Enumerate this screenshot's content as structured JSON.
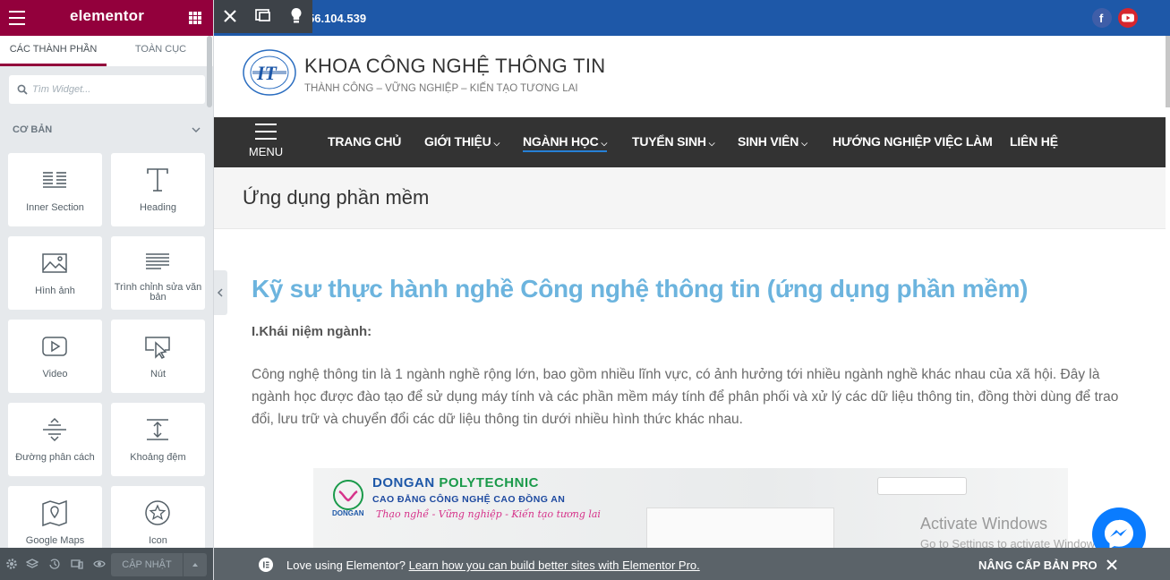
{
  "panel": {
    "brand": "elementor",
    "tabs": [
      "CÁC THÀNH PHẦN",
      "TOÀN CỤC"
    ],
    "search_placeholder": "Tìm Widget...",
    "category": "CƠ BẢN",
    "widgets": [
      {
        "label": "Inner Section",
        "icon": "inner-section-icon"
      },
      {
        "label": "Heading",
        "icon": "heading-icon"
      },
      {
        "label": "Hình ảnh",
        "icon": "image-icon"
      },
      {
        "label": "Trình chỉnh sửa văn bản",
        "icon": "text-editor-icon"
      },
      {
        "label": "Video",
        "icon": "video-icon"
      },
      {
        "label": "Nút",
        "icon": "button-icon"
      },
      {
        "label": "Đường phân cách",
        "icon": "divider-icon"
      },
      {
        "label": "Khoảng đệm",
        "icon": "spacer-icon"
      },
      {
        "label": "Google Maps",
        "icon": "google-maps-icon"
      },
      {
        "label": "Icon",
        "icon": "star-icon"
      }
    ],
    "footer": {
      "update_label": "CẬP NHẬT"
    }
  },
  "site": {
    "phone": "56.104.539",
    "title": "KHOA CÔNG NGHỆ THÔNG TIN",
    "tagline": "THÀNH CÔNG – VỮNG NGHIỆP – KIẾN TẠO TƯƠNG LAI",
    "menu_label": "MENU",
    "nav": [
      {
        "label": "TRANG CHỦ",
        "dropdown": false
      },
      {
        "label": "GIỚI THIỆU",
        "dropdown": true
      },
      {
        "label": "NGÀNH HỌC",
        "dropdown": true,
        "current": true
      },
      {
        "label": "TUYỂN SINH",
        "dropdown": true
      },
      {
        "label": "SINH VIÊN",
        "dropdown": true
      },
      {
        "label": "HƯỚNG NGHIỆP VIỆC LÀM",
        "dropdown": false
      },
      {
        "label": "LIÊN HỆ",
        "dropdown": false
      }
    ],
    "page_title": "Ứng dụng phần mềm",
    "article": {
      "title": "Kỹ sư thực hành nghề Công nghệ thông tin (ứng dụng phần mềm)",
      "heading": "I.Khái niệm ngành:",
      "paragraph": "Công nghệ thông tin là 1 ngành nghề rộng lớn, bao gồm nhiều lĩnh vực, có ảnh hưởng tới nhiều ngành nghề khác nhau của xã hội. Đây là ngành học được đào tạo để sử dụng máy tính và các phần mềm máy tính để phân phối và xử lý các dữ liệu thông tin, đồng thời dùng để trao đổi, lưu trữ và chuyển đổi các dữ liệu thông tin dưới nhiều hình thức khác nhau."
    },
    "banner": {
      "line1a": "DONGAN",
      "line1b": " POLYTECHNIC",
      "line2": "CAO ĐẲNG CÔNG NGHỆ CAO ĐỒNG AN",
      "line3": "Thạo nghề - Vững nghiệp - Kiến tạo tương lai",
      "logo_text": "DONGAN"
    }
  },
  "watermark": {
    "line1": "Activate Windows",
    "line2": "Go to Settings to activate Windows."
  },
  "notice": {
    "text": "Love using Elementor? ",
    "link": "Learn how you can build better sites with Elementor Pro.",
    "upgrade": "NÂNG CẤP BẢN PRO"
  },
  "colors": {
    "panel_header": "#93003c",
    "topbar": "#1e58a8",
    "nav": "#333333",
    "title_blue": "#6cb4de"
  }
}
